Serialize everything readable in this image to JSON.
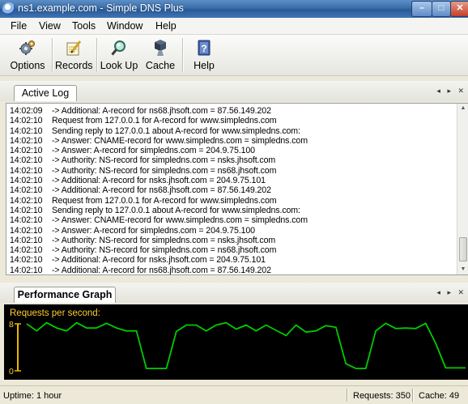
{
  "window": {
    "title": "ns1.example.com - Simple DNS Plus",
    "min_glyph": "–",
    "max_glyph": "□",
    "close_glyph": "✕"
  },
  "menu": {
    "items": [
      "File",
      "View",
      "Tools",
      "Window",
      "Help"
    ]
  },
  "toolbar": {
    "buttons": [
      {
        "label": "Options",
        "icon": "gear-icon"
      },
      {
        "label": "Records",
        "icon": "notepad-pencil-icon"
      },
      {
        "label": "Look Up",
        "icon": "magnifier-icon"
      },
      {
        "label": "Cache",
        "icon": "server-cache-icon"
      },
      {
        "label": "Help",
        "icon": "help-book-icon"
      }
    ]
  },
  "active_log": {
    "tab_label": "Active Log",
    "controls": "◂ ▸ ✕",
    "lines": [
      {
        "time": "14:02:09",
        "text": "-> Additional: A-record for ns68.jhsoft.com = 87.56.149.202"
      },
      {
        "time": "14:02:10",
        "text": "Request from 127.0.0.1 for A-record for www.simpledns.com"
      },
      {
        "time": "14:02:10",
        "text": "Sending reply to 127.0.0.1 about A-record for www.simpledns.com:"
      },
      {
        "time": "14:02:10",
        "text": "-> Answer: CNAME-record for www.simpledns.com = simpledns.com"
      },
      {
        "time": "14:02:10",
        "text": "-> Answer: A-record for simpledns.com = 204.9.75.100"
      },
      {
        "time": "14:02:10",
        "text": "-> Authority: NS-record for simpledns.com = nsks.jhsoft.com"
      },
      {
        "time": "14:02:10",
        "text": "-> Authority: NS-record for simpledns.com = ns68.jhsoft.com"
      },
      {
        "time": "14:02:10",
        "text": "-> Additional: A-record for nsks.jhsoft.com = 204.9.75.101"
      },
      {
        "time": "14:02:10",
        "text": "-> Additional: A-record for ns68.jhsoft.com = 87.56.149.202"
      },
      {
        "time": "14:02:10",
        "text": "Request from 127.0.0.1 for A-record for www.simpledns.com"
      },
      {
        "time": "14:02:10",
        "text": "Sending reply to 127.0.0.1 about A-record for www.simpledns.com:"
      },
      {
        "time": "14:02:10",
        "text": "-> Answer: CNAME-record for www.simpledns.com = simpledns.com"
      },
      {
        "time": "14:02:10",
        "text": "-> Answer: A-record for simpledns.com = 204.9.75.100"
      },
      {
        "time": "14:02:10",
        "text": "-> Authority: NS-record for simpledns.com = nsks.jhsoft.com"
      },
      {
        "time": "14:02:10",
        "text": "-> Authority: NS-record for simpledns.com = ns68.jhsoft.com"
      },
      {
        "time": "14:02:10",
        "text": "-> Additional: A-record for nsks.jhsoft.com = 204.9.75.101"
      },
      {
        "time": "14:02:10",
        "text": "-> Additional: A-record for ns68.jhsoft.com = 87.56.149.202"
      }
    ]
  },
  "performance_graph": {
    "tab_label": "Performance Graph",
    "controls": "◂ ▸ ✕",
    "colors": {
      "background": "#000000",
      "line": "#00cc00",
      "label": "#ffcc33",
      "axis": "#e8b800"
    },
    "chart_data": {
      "type": "line",
      "title": "Requests per second:",
      "ylim": [
        0,
        8
      ],
      "y_ticks": [
        "8",
        "0"
      ],
      "values": [
        8,
        6.8,
        8.2,
        7.3,
        6.8,
        8.2,
        7.3,
        7.3,
        8.1,
        7.3,
        6.8,
        6.8,
        0.4,
        0.4,
        0.4,
        6.7,
        7.8,
        7.8,
        6.8,
        7.8,
        8.2,
        7.1,
        7.8,
        6.8,
        7.8,
        6.9,
        6.0,
        7.8,
        6.6,
        6.8,
        7.7,
        7.4,
        1.2,
        0.4,
        0.4,
        6.8,
        8.1,
        7.2,
        7.3,
        7.2,
        8.1,
        4.7,
        0.5,
        0.5,
        0.5
      ]
    }
  },
  "status": {
    "uptime": "Uptime: 1 hour",
    "requests": "Requests: 350",
    "cache": "Cache: 49"
  }
}
